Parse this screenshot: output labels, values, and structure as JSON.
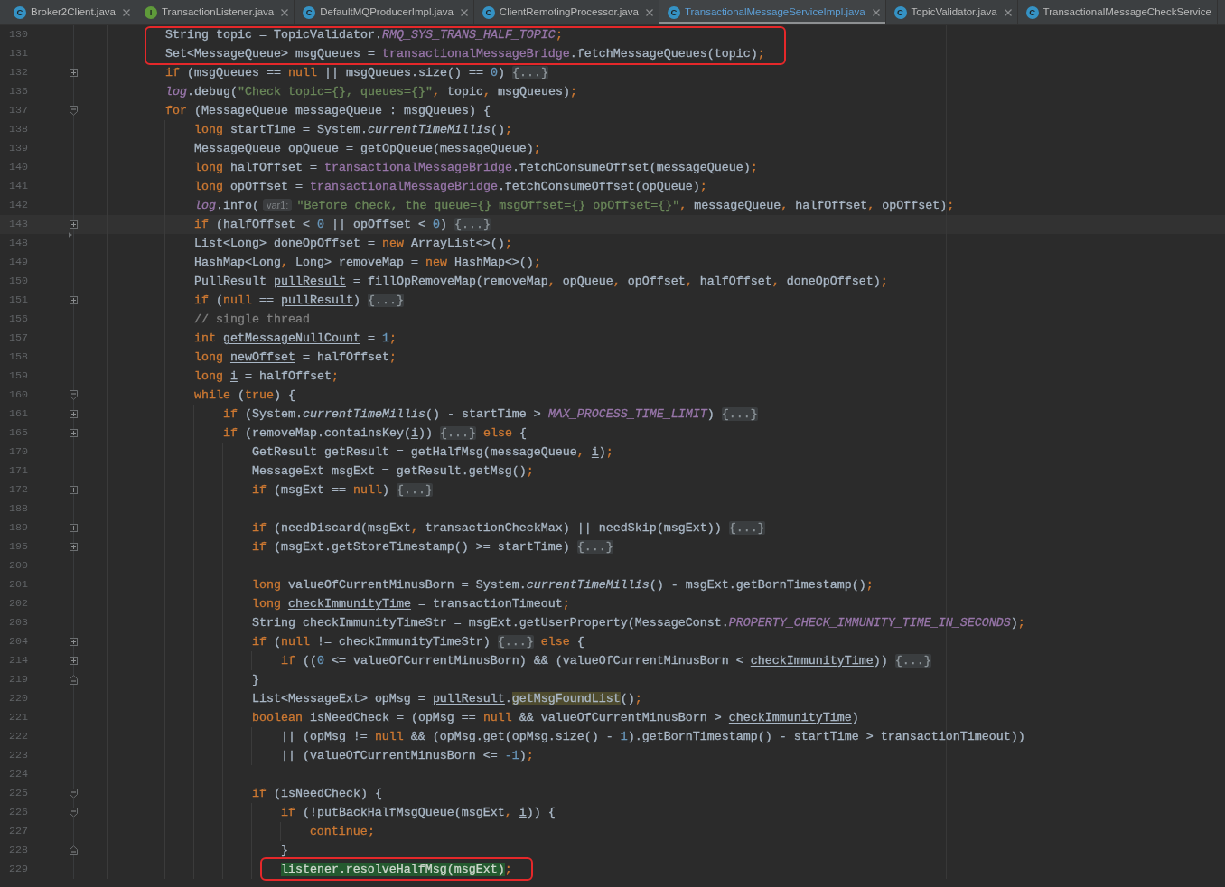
{
  "tabs": [
    {
      "kind": "class",
      "icon_letter": "C",
      "label": "Broker2Client.java",
      "selected": false,
      "closable": true
    },
    {
      "kind": "interface",
      "icon_letter": "I",
      "label": "TransactionListener.java",
      "selected": false,
      "closable": true
    },
    {
      "kind": "class",
      "icon_letter": "C",
      "label": "DefaultMQProducerImpl.java",
      "selected": false,
      "closable": true
    },
    {
      "kind": "class",
      "icon_letter": "C",
      "label": "ClientRemotingProcessor.java",
      "selected": false,
      "closable": true
    },
    {
      "kind": "class",
      "icon_letter": "C",
      "label": "TransactionalMessageServiceImpl.java",
      "selected": true,
      "closable": true
    },
    {
      "kind": "class",
      "icon_letter": "C",
      "label": "TopicValidator.java",
      "selected": false,
      "closable": true
    },
    {
      "kind": "class",
      "icon_letter": "C",
      "label": "TransactionalMessageCheckService",
      "selected": false,
      "closable": false
    }
  ],
  "editor": {
    "lines": [
      {
        "number": "130",
        "current": false,
        "framed": true,
        "code": [
          {
            "kind": "plain",
            "text": "            String topic = TopicValidator."
          },
          {
            "kind": "constant",
            "text": "RMQ_SYS_TRANS_HALF_TOPIC"
          },
          {
            "kind": "keyword",
            "text": ";"
          }
        ]
      },
      {
        "number": "131",
        "current": false,
        "framed": true,
        "code": [
          {
            "kind": "plain",
            "text": "            Set<MessageQueue> msgQueues = "
          },
          {
            "kind": "field",
            "text": "transactionalMessageBridge"
          },
          {
            "kind": "plain",
            "text": ".fetchMessageQueues(topic)"
          },
          {
            "kind": "keyword",
            "text": ";"
          }
        ]
      },
      {
        "number": "132",
        "current": false,
        "framed": false,
        "gutter_icon": {
          "kind": "collapsed"
        },
        "code": [
          {
            "kind": "keyword",
            "text": "            if"
          },
          {
            "kind": "plain",
            "text": " (msgQueues == "
          },
          {
            "kind": "keyword",
            "text": "null"
          },
          {
            "kind": "plain",
            "text": " || msgQueues.size() == "
          },
          {
            "kind": "number",
            "text": "0"
          },
          {
            "kind": "plain",
            "text": ") "
          },
          {
            "kind": "folded",
            "text": "{...}"
          }
        ]
      },
      {
        "number": "136",
        "current": false,
        "framed": false,
        "code": [
          {
            "kind": "constant",
            "text": "            log"
          },
          {
            "kind": "plain",
            "text": ".debug("
          },
          {
            "kind": "string",
            "text": "\"Check topic={}, queues={}\""
          },
          {
            "kind": "keyword",
            "text": ","
          },
          {
            "kind": "plain",
            "text": " topic"
          },
          {
            "kind": "keyword",
            "text": ","
          },
          {
            "kind": "plain",
            "text": " msgQueues)"
          },
          {
            "kind": "keyword",
            "text": ";"
          }
        ]
      },
      {
        "number": "137",
        "current": false,
        "framed": false,
        "gutter_icon": {
          "kind": "block_start"
        },
        "code": [
          {
            "kind": "keyword",
            "text": "            for"
          },
          {
            "kind": "plain",
            "text": " (MessageQueue messageQueue : msgQueues) {"
          }
        ]
      },
      {
        "number": "138",
        "current": false,
        "framed": false,
        "code": [
          {
            "kind": "keyword",
            "text": "                long"
          },
          {
            "kind": "plain",
            "text": " startTime = System."
          },
          {
            "kind": "static_method",
            "text": "currentTimeMillis"
          },
          {
            "kind": "plain",
            "text": "()"
          },
          {
            "kind": "keyword",
            "text": ";"
          }
        ]
      },
      {
        "number": "139",
        "current": false,
        "framed": false,
        "code": [
          {
            "kind": "plain",
            "text": "                MessageQueue opQueue = getOpQueue(messageQueue)"
          },
          {
            "kind": "keyword",
            "text": ";"
          }
        ]
      },
      {
        "number": "140",
        "current": false,
        "framed": false,
        "code": [
          {
            "kind": "keyword",
            "text": "                long"
          },
          {
            "kind": "plain",
            "text": " halfOffset = "
          },
          {
            "kind": "field",
            "text": "transactionalMessageBridge"
          },
          {
            "kind": "plain",
            "text": ".fetchConsumeOffset(messageQueue)"
          },
          {
            "kind": "keyword",
            "text": ";"
          }
        ]
      },
      {
        "number": "141",
        "current": false,
        "framed": false,
        "code": [
          {
            "kind": "keyword",
            "text": "                long"
          },
          {
            "kind": "plain",
            "text": " opOffset = "
          },
          {
            "kind": "field",
            "text": "transactionalMessageBridge"
          },
          {
            "kind": "plain",
            "text": ".fetchConsumeOffset(opQueue)"
          },
          {
            "kind": "keyword",
            "text": ";"
          }
        ]
      },
      {
        "number": "142",
        "current": false,
        "framed": false,
        "code": [
          {
            "kind": "constant",
            "text": "                log"
          },
          {
            "kind": "plain",
            "text": ".info("
          },
          {
            "kind": "param_hint",
            "text": "var1:"
          },
          {
            "kind": "string",
            "text": "\"Before check, the queue={} msgOffset={} opOffset={}\""
          },
          {
            "kind": "keyword",
            "text": ","
          },
          {
            "kind": "plain",
            "text": " messageQueue"
          },
          {
            "kind": "keyword",
            "text": ","
          },
          {
            "kind": "plain",
            "text": " halfOffset"
          },
          {
            "kind": "keyword",
            "text": ","
          },
          {
            "kind": "plain",
            "text": " opOffset)"
          },
          {
            "kind": "keyword",
            "text": ";"
          }
        ]
      },
      {
        "number": "143",
        "current": true,
        "framed": false,
        "gutter_icon": {
          "kind": "collapsed"
        },
        "code": [
          {
            "kind": "keyword",
            "text": "                if"
          },
          {
            "kind": "plain",
            "text": " (halfOffset < "
          },
          {
            "kind": "number",
            "text": "0"
          },
          {
            "kind": "plain",
            "text": " || opOffset < "
          },
          {
            "kind": "number",
            "text": "0"
          },
          {
            "kind": "plain",
            "text": ") "
          },
          {
            "kind": "folded",
            "text": "{...}"
          }
        ]
      },
      {
        "number": "148",
        "current": false,
        "framed": false,
        "gutter_icon": {
          "kind": "arrow"
        },
        "code": [
          {
            "kind": "plain",
            "text": "                List<Long> doneOpOffset = "
          },
          {
            "kind": "keyword",
            "text": "new"
          },
          {
            "kind": "plain",
            "text": " ArrayList<>()"
          },
          {
            "kind": "keyword",
            "text": ";"
          }
        ]
      },
      {
        "number": "149",
        "current": false,
        "framed": false,
        "code": [
          {
            "kind": "plain",
            "text": "                HashMap<Long"
          },
          {
            "kind": "keyword",
            "text": ","
          },
          {
            "kind": "plain",
            "text": " Long> removeMap = "
          },
          {
            "kind": "keyword",
            "text": "new"
          },
          {
            "kind": "plain",
            "text": " HashMap<>()"
          },
          {
            "kind": "keyword",
            "text": ";"
          }
        ]
      },
      {
        "number": "150",
        "current": false,
        "framed": false,
        "code": [
          {
            "kind": "plain",
            "text": "                PullResult "
          },
          {
            "kind": "reassigned",
            "text": "pullResult"
          },
          {
            "kind": "plain",
            "text": " = fillOpRemoveMap(removeMap"
          },
          {
            "kind": "keyword",
            "text": ","
          },
          {
            "kind": "plain",
            "text": " opQueue"
          },
          {
            "kind": "keyword",
            "text": ","
          },
          {
            "kind": "plain",
            "text": " opOffset"
          },
          {
            "kind": "keyword",
            "text": ","
          },
          {
            "kind": "plain",
            "text": " halfOffset"
          },
          {
            "kind": "keyword",
            "text": ","
          },
          {
            "kind": "plain",
            "text": " doneOpOffset)"
          },
          {
            "kind": "keyword",
            "text": ";"
          }
        ]
      },
      {
        "number": "151",
        "current": false,
        "framed": false,
        "gutter_icon": {
          "kind": "collapsed"
        },
        "code": [
          {
            "kind": "keyword",
            "text": "                if"
          },
          {
            "kind": "plain",
            "text": " ("
          },
          {
            "kind": "keyword",
            "text": "null"
          },
          {
            "kind": "plain",
            "text": " == "
          },
          {
            "kind": "reassigned",
            "text": "pullResult"
          },
          {
            "kind": "plain",
            "text": ") "
          },
          {
            "kind": "folded",
            "text": "{...}"
          }
        ]
      },
      {
        "number": "156",
        "current": false,
        "framed": false,
        "code": [
          {
            "kind": "comment",
            "text": "                // single thread"
          }
        ]
      },
      {
        "number": "157",
        "current": false,
        "framed": false,
        "code": [
          {
            "kind": "keyword",
            "text": "                int "
          },
          {
            "kind": "reassigned",
            "text": "getMessageNullCount"
          },
          {
            "kind": "plain",
            "text": " = "
          },
          {
            "kind": "number",
            "text": "1"
          },
          {
            "kind": "keyword",
            "text": ";"
          }
        ]
      },
      {
        "number": "158",
        "current": false,
        "framed": false,
        "code": [
          {
            "kind": "keyword",
            "text": "                long "
          },
          {
            "kind": "reassigned",
            "text": "newOffset"
          },
          {
            "kind": "plain",
            "text": " = halfOffset"
          },
          {
            "kind": "keyword",
            "text": ";"
          }
        ]
      },
      {
        "number": "159",
        "current": false,
        "framed": false,
        "code": [
          {
            "kind": "keyword",
            "text": "                long "
          },
          {
            "kind": "reassigned",
            "text": "i"
          },
          {
            "kind": "plain",
            "text": " = halfOffset"
          },
          {
            "kind": "keyword",
            "text": ";"
          }
        ]
      },
      {
        "number": "160",
        "current": false,
        "framed": false,
        "gutter_icon": {
          "kind": "block_start"
        },
        "code": [
          {
            "kind": "keyword",
            "text": "                while"
          },
          {
            "kind": "plain",
            "text": " ("
          },
          {
            "kind": "keyword",
            "text": "true"
          },
          {
            "kind": "plain",
            "text": ") {"
          }
        ]
      },
      {
        "number": "161",
        "current": false,
        "framed": false,
        "gutter_icon": {
          "kind": "collapsed"
        },
        "code": [
          {
            "kind": "keyword",
            "text": "                    if"
          },
          {
            "kind": "plain",
            "text": " (System."
          },
          {
            "kind": "static_method",
            "text": "currentTimeMillis"
          },
          {
            "kind": "plain",
            "text": "() - startTime > "
          },
          {
            "kind": "constant",
            "text": "MAX_PROCESS_TIME_LIMIT"
          },
          {
            "kind": "plain",
            "text": ") "
          },
          {
            "kind": "folded",
            "text": "{...}"
          }
        ]
      },
      {
        "number": "165",
        "current": false,
        "framed": false,
        "gutter_icon": {
          "kind": "collapsed"
        },
        "code": [
          {
            "kind": "keyword",
            "text": "                    if"
          },
          {
            "kind": "plain",
            "text": " (removeMap.containsKey("
          },
          {
            "kind": "reassigned",
            "text": "i"
          },
          {
            "kind": "plain",
            "text": ")) "
          },
          {
            "kind": "folded",
            "text": "{...}"
          },
          {
            "kind": "keyword",
            "text": " else"
          },
          {
            "kind": "plain",
            "text": " {"
          }
        ]
      },
      {
        "number": "170",
        "current": false,
        "framed": false,
        "code": [
          {
            "kind": "plain",
            "text": "                        GetResult getResult = getHalfMsg(messageQueue"
          },
          {
            "kind": "keyword",
            "text": ", "
          },
          {
            "kind": "reassigned",
            "text": "i"
          },
          {
            "kind": "plain",
            "text": ")"
          },
          {
            "kind": "keyword",
            "text": ";"
          }
        ]
      },
      {
        "number": "171",
        "current": false,
        "framed": false,
        "code": [
          {
            "kind": "plain",
            "text": "                        MessageExt msgExt = getResult.getMsg()"
          },
          {
            "kind": "keyword",
            "text": ";"
          }
        ]
      },
      {
        "number": "172",
        "current": false,
        "framed": false,
        "gutter_icon": {
          "kind": "collapsed"
        },
        "code": [
          {
            "kind": "keyword",
            "text": "                        if"
          },
          {
            "kind": "plain",
            "text": " (msgExt == "
          },
          {
            "kind": "keyword",
            "text": "null"
          },
          {
            "kind": "plain",
            "text": ") "
          },
          {
            "kind": "folded",
            "text": "{...}"
          }
        ]
      },
      {
        "number": "188",
        "current": false,
        "framed": false
      },
      {
        "number": "189",
        "current": false,
        "framed": false,
        "gutter_icon": {
          "kind": "collapsed"
        },
        "code": [
          {
            "kind": "keyword",
            "text": "                        if"
          },
          {
            "kind": "plain",
            "text": " (needDiscard(msgExt"
          },
          {
            "kind": "keyword",
            "text": ","
          },
          {
            "kind": "plain",
            "text": " transactionCheckMax) || needSkip(msgExt)) "
          },
          {
            "kind": "folded",
            "text": "{...}"
          }
        ]
      },
      {
        "number": "195",
        "current": false,
        "framed": false,
        "gutter_icon": {
          "kind": "collapsed"
        },
        "code": [
          {
            "kind": "keyword",
            "text": "                        if"
          },
          {
            "kind": "plain",
            "text": " (msgExt.getStoreTimestamp() >= startTime) "
          },
          {
            "kind": "folded",
            "text": "{...}"
          }
        ]
      },
      {
        "number": "200",
        "current": false,
        "framed": false
      },
      {
        "number": "201",
        "current": false,
        "framed": false,
        "code": [
          {
            "kind": "keyword",
            "text": "                        long"
          },
          {
            "kind": "plain",
            "text": " valueOfCurrentMinusBorn = System."
          },
          {
            "kind": "static_method",
            "text": "currentTimeMillis"
          },
          {
            "kind": "plain",
            "text": "() - msgExt.getBornTimestamp()"
          },
          {
            "kind": "keyword",
            "text": ";"
          }
        ]
      },
      {
        "number": "202",
        "current": false,
        "framed": false,
        "code": [
          {
            "kind": "keyword",
            "text": "                        long "
          },
          {
            "kind": "reassigned",
            "text": "checkImmunityTime"
          },
          {
            "kind": "plain",
            "text": " = transactionTimeout"
          },
          {
            "kind": "keyword",
            "text": ";"
          }
        ]
      },
      {
        "number": "203",
        "current": false,
        "framed": false,
        "code": [
          {
            "kind": "plain",
            "text": "                        String checkImmunityTimeStr = msgExt.getUserProperty(MessageConst."
          },
          {
            "kind": "constant",
            "text": "PROPERTY_CHECK_IMMUNITY_TIME_IN_SECONDS"
          },
          {
            "kind": "plain",
            "text": ")"
          },
          {
            "kind": "keyword",
            "text": ";"
          }
        ]
      },
      {
        "number": "204",
        "current": false,
        "framed": false,
        "gutter_icon": {
          "kind": "collapsed"
        },
        "code": [
          {
            "kind": "keyword",
            "text": "                        if"
          },
          {
            "kind": "plain",
            "text": " ("
          },
          {
            "kind": "keyword",
            "text": "null"
          },
          {
            "kind": "plain",
            "text": " != checkImmunityTimeStr) "
          },
          {
            "kind": "folded",
            "text": "{...}"
          },
          {
            "kind": "keyword",
            "text": " else"
          },
          {
            "kind": "plain",
            "text": " {"
          }
        ]
      },
      {
        "number": "214",
        "current": false,
        "framed": false,
        "gutter_icon": {
          "kind": "collapsed"
        },
        "code": [
          {
            "kind": "keyword",
            "text": "                            if"
          },
          {
            "kind": "plain",
            "text": " (("
          },
          {
            "kind": "number",
            "text": "0"
          },
          {
            "kind": "plain",
            "text": " <= valueOfCurrentMinusBorn) && (valueOfCurrentMinusBorn < "
          },
          {
            "kind": "reassigned",
            "text": "checkImmunityTime"
          },
          {
            "kind": "plain",
            "text": ")) "
          },
          {
            "kind": "folded",
            "text": "{...}"
          }
        ]
      },
      {
        "number": "219",
        "current": false,
        "framed": false,
        "gutter_icon": {
          "kind": "block_end"
        },
        "code": [
          {
            "kind": "plain",
            "text": "                        }"
          }
        ]
      },
      {
        "number": "220",
        "current": false,
        "framed": false,
        "code": [
          {
            "kind": "plain",
            "text": "                        List<MessageExt> opMsg = "
          },
          {
            "kind": "reassigned",
            "text": "pullResult"
          },
          {
            "kind": "plain",
            "text": "."
          },
          {
            "kind": "usage_match",
            "text": "getMsgFoundList"
          },
          {
            "kind": "plain",
            "text": "()"
          },
          {
            "kind": "keyword",
            "text": ";"
          }
        ]
      },
      {
        "number": "221",
        "current": false,
        "framed": false,
        "code": [
          {
            "kind": "keyword",
            "text": "                        boolean"
          },
          {
            "kind": "plain",
            "text": " isNeedCheck = (opMsg == "
          },
          {
            "kind": "keyword",
            "text": "null"
          },
          {
            "kind": "plain",
            "text": " && valueOfCurrentMinusBorn > "
          },
          {
            "kind": "reassigned",
            "text": "checkImmunityTime"
          },
          {
            "kind": "plain",
            "text": ")"
          }
        ]
      },
      {
        "number": "222",
        "current": false,
        "framed": false,
        "code": [
          {
            "kind": "plain",
            "text": "                            || (opMsg != "
          },
          {
            "kind": "keyword",
            "text": "null"
          },
          {
            "kind": "plain",
            "text": " && (opMsg.get(opMsg.size() - "
          },
          {
            "kind": "number",
            "text": "1"
          },
          {
            "kind": "plain",
            "text": ").getBornTimestamp() - startTime > transactionTimeout))"
          }
        ]
      },
      {
        "number": "223",
        "current": false,
        "framed": false,
        "code": [
          {
            "kind": "plain",
            "text": "                            || (valueOfCurrentMinusBorn <= "
          },
          {
            "kind": "number",
            "text": "-1"
          },
          {
            "kind": "plain",
            "text": ")"
          },
          {
            "kind": "keyword",
            "text": ";"
          }
        ]
      },
      {
        "number": "224",
        "current": false,
        "framed": false
      },
      {
        "number": "225",
        "current": false,
        "framed": false,
        "gutter_icon": {
          "kind": "block_start"
        },
        "code": [
          {
            "kind": "keyword",
            "text": "                        if"
          },
          {
            "kind": "plain",
            "text": " (isNeedCheck) {"
          }
        ]
      },
      {
        "number": "226",
        "current": false,
        "framed": false,
        "gutter_icon": {
          "kind": "block_start"
        },
        "code": [
          {
            "kind": "keyword",
            "text": "                            if"
          },
          {
            "kind": "plain",
            "text": " (!putBackHalfMsgQueue(msgExt"
          },
          {
            "kind": "keyword",
            "text": ", "
          },
          {
            "kind": "reassigned",
            "text": "i"
          },
          {
            "kind": "plain",
            "text": ")) {"
          }
        ]
      },
      {
        "number": "227",
        "current": false,
        "framed": false,
        "code": [
          {
            "kind": "keyword",
            "text": "                                continue"
          },
          {
            "kind": "keyword",
            "text": ";"
          }
        ]
      },
      {
        "number": "228",
        "current": false,
        "framed": false,
        "gutter_icon": {
          "kind": "block_end"
        },
        "code": [
          {
            "kind": "plain",
            "text": "                            }"
          }
        ]
      },
      {
        "number": "229",
        "current": false,
        "framed": true,
        "code": [
          {
            "kind": "marked",
            "text": "                            listener.resolveHalfMsg(msgExt)"
          },
          {
            "kind": "keyword",
            "text": ";"
          }
        ]
      }
    ]
  }
}
